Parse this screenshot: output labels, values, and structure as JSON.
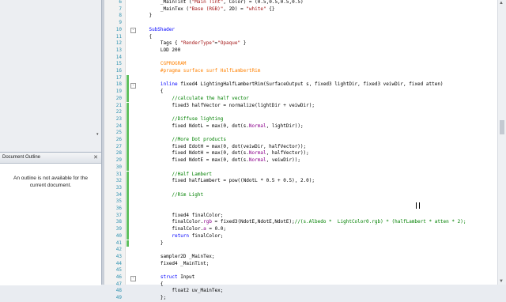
{
  "outline": {
    "title": "Document Outline",
    "close_glyph": "✕",
    "message": "An outline is not available for the current document."
  },
  "colors": {
    "keyword": "#0000ff",
    "string": "#a31515",
    "comment": "#008000",
    "number": "#000000",
    "preprocessor": "#ff8000",
    "field": "#8b008b",
    "changed": "#5fbf5f"
  },
  "code_lines": [
    {
      "n": "6",
      "fold": "",
      "changed": false,
      "segs": [
        {
          "t": "        ",
          "c": ""
        },
        {
          "t": "_MainTint",
          "c": ""
        },
        {
          "t": " (",
          "c": ""
        },
        {
          "t": "\"Main Tint\"",
          "c": "str"
        },
        {
          "t": ", Color) = (",
          "c": ""
        },
        {
          "t": "0.5,0.5,0.5,0.5",
          "c": "num"
        },
        {
          "t": ")",
          "c": ""
        }
      ]
    },
    {
      "n": "7",
      "fold": "",
      "changed": false,
      "segs": [
        {
          "t": "        _MainTex (",
          "c": ""
        },
        {
          "t": "\"Base (RGB)\"",
          "c": "str"
        },
        {
          "t": ", 2D) = ",
          "c": ""
        },
        {
          "t": "\"white\"",
          "c": "str"
        },
        {
          "t": " {}",
          "c": ""
        }
      ]
    },
    {
      "n": "8",
      "fold": "",
      "changed": false,
      "segs": [
        {
          "t": "    }",
          "c": ""
        }
      ]
    },
    {
      "n": "9",
      "fold": "",
      "changed": false,
      "segs": [
        {
          "t": "",
          "c": ""
        }
      ]
    },
    {
      "n": "10",
      "fold": "-",
      "changed": false,
      "segs": [
        {
          "t": "    ",
          "c": ""
        },
        {
          "t": "SubShader",
          "c": "kw"
        }
      ]
    },
    {
      "n": "11",
      "fold": "",
      "changed": false,
      "segs": [
        {
          "t": "    {",
          "c": ""
        }
      ]
    },
    {
      "n": "12",
      "fold": "",
      "changed": false,
      "segs": [
        {
          "t": "        Tags { ",
          "c": ""
        },
        {
          "t": "\"RenderType\"",
          "c": "str"
        },
        {
          "t": "=",
          "c": ""
        },
        {
          "t": "\"Opaque\"",
          "c": "str"
        },
        {
          "t": " }",
          "c": ""
        }
      ]
    },
    {
      "n": "13",
      "fold": "",
      "changed": false,
      "segs": [
        {
          "t": "        LOD ",
          "c": ""
        },
        {
          "t": "200",
          "c": "num"
        }
      ]
    },
    {
      "n": "14",
      "fold": "",
      "changed": false,
      "segs": [
        {
          "t": "",
          "c": ""
        }
      ]
    },
    {
      "n": "15",
      "fold": "",
      "changed": false,
      "segs": [
        {
          "t": "        ",
          "c": ""
        },
        {
          "t": "CGPROGRAM",
          "c": "pre"
        }
      ]
    },
    {
      "n": "16",
      "fold": "",
      "changed": false,
      "segs": [
        {
          "t": "        ",
          "c": ""
        },
        {
          "t": "#pragma surface surf HalfLambertRim",
          "c": "pre"
        }
      ]
    },
    {
      "n": "17",
      "fold": "",
      "changed": true,
      "segs": [
        {
          "t": "",
          "c": ""
        }
      ]
    },
    {
      "n": "18",
      "fold": "-",
      "changed": true,
      "segs": [
        {
          "t": "        ",
          "c": ""
        },
        {
          "t": "inline",
          "c": "kw"
        },
        {
          "t": " fixed4 LightingHalfLambertRim(SurfaceOutput s, fixed3 lightDir, fixed3 veiwDir, fixed atten)",
          "c": ""
        }
      ]
    },
    {
      "n": "19",
      "fold": "",
      "changed": true,
      "segs": [
        {
          "t": "        {",
          "c": ""
        }
      ]
    },
    {
      "n": "20",
      "fold": "",
      "changed": true,
      "segs": [
        {
          "t": "            ",
          "c": ""
        },
        {
          "t": "//calculate the half vector",
          "c": "com"
        }
      ]
    },
    {
      "n": "21",
      "fold": "",
      "changed": true,
      "segs": [
        {
          "t": "            fixed3 halfVector = normalize(lightDir + veiwDir);",
          "c": ""
        }
      ]
    },
    {
      "n": "22",
      "fold": "",
      "changed": true,
      "segs": [
        {
          "t": "",
          "c": ""
        }
      ]
    },
    {
      "n": "23",
      "fold": "",
      "changed": true,
      "segs": [
        {
          "t": "            ",
          "c": ""
        },
        {
          "t": "//Diffuse lighting",
          "c": "com"
        }
      ]
    },
    {
      "n": "24",
      "fold": "",
      "changed": true,
      "segs": [
        {
          "t": "            fixed NdotL = max(",
          "c": ""
        },
        {
          "t": "0",
          "c": "num"
        },
        {
          "t": ", dot(s.",
          "c": ""
        },
        {
          "t": "Normal",
          "c": "fld"
        },
        {
          "t": ", lightDir));",
          "c": ""
        }
      ]
    },
    {
      "n": "25",
      "fold": "",
      "changed": true,
      "segs": [
        {
          "t": "",
          "c": ""
        }
      ]
    },
    {
      "n": "26",
      "fold": "",
      "changed": true,
      "segs": [
        {
          "t": "            ",
          "c": ""
        },
        {
          "t": "//More Dot products",
          "c": "com"
        }
      ]
    },
    {
      "n": "27",
      "fold": "",
      "changed": true,
      "segs": [
        {
          "t": "            fixed EdotH = max(",
          "c": ""
        },
        {
          "t": "0",
          "c": "num"
        },
        {
          "t": ", dot(veiwDir, halfVector));",
          "c": ""
        }
      ]
    },
    {
      "n": "28",
      "fold": "",
      "changed": true,
      "segs": [
        {
          "t": "            fixed NdotH = max(",
          "c": ""
        },
        {
          "t": "0",
          "c": "num"
        },
        {
          "t": ", dot(s.",
          "c": ""
        },
        {
          "t": "Normal",
          "c": "fld"
        },
        {
          "t": ", halfVector));",
          "c": ""
        }
      ]
    },
    {
      "n": "29",
      "fold": "",
      "changed": true,
      "segs": [
        {
          "t": "            fixed NdotE = max(",
          "c": ""
        },
        {
          "t": "0",
          "c": "num"
        },
        {
          "t": ", dot(s.",
          "c": ""
        },
        {
          "t": "Normal",
          "c": "fld"
        },
        {
          "t": ", veiwDir));",
          "c": ""
        }
      ]
    },
    {
      "n": "30",
      "fold": "",
      "changed": true,
      "segs": [
        {
          "t": "",
          "c": ""
        }
      ]
    },
    {
      "n": "31",
      "fold": "",
      "changed": true,
      "segs": [
        {
          "t": "            ",
          "c": ""
        },
        {
          "t": "//Half Lambert",
          "c": "com"
        }
      ]
    },
    {
      "n": "32",
      "fold": "",
      "changed": true,
      "segs": [
        {
          "t": "            fixed halfLambert = pow((NdotL * ",
          "c": ""
        },
        {
          "t": "0.5",
          "c": "num"
        },
        {
          "t": " + ",
          "c": ""
        },
        {
          "t": "0.5",
          "c": "num"
        },
        {
          "t": "), ",
          "c": ""
        },
        {
          "t": "2.0",
          "c": "num"
        },
        {
          "t": ");",
          "c": ""
        }
      ]
    },
    {
      "n": "33",
      "fold": "",
      "changed": true,
      "segs": [
        {
          "t": "",
          "c": ""
        }
      ]
    },
    {
      "n": "34",
      "fold": "",
      "changed": true,
      "segs": [
        {
          "t": "            ",
          "c": ""
        },
        {
          "t": "//Rim Light",
          "c": "com"
        }
      ]
    },
    {
      "n": "35",
      "fold": "",
      "changed": true,
      "segs": [
        {
          "t": "",
          "c": ""
        }
      ]
    },
    {
      "n": "36",
      "fold": "",
      "changed": true,
      "segs": [
        {
          "t": "",
          "c": ""
        }
      ]
    },
    {
      "n": "37",
      "fold": "",
      "changed": true,
      "segs": [
        {
          "t": "            fixed4 finalColor;",
          "c": ""
        }
      ]
    },
    {
      "n": "38",
      "fold": "",
      "changed": true,
      "segs": [
        {
          "t": "            finalColor.",
          "c": ""
        },
        {
          "t": "rgb",
          "c": "fld"
        },
        {
          "t": " = fixed3(NdotE,NdotE,NdotE);",
          "c": ""
        },
        {
          "t": "//(s.Albedo *  LightColor0.rgb) * (halfLambert * atten * 2);",
          "c": "com"
        }
      ]
    },
    {
      "n": "39",
      "fold": "",
      "changed": true,
      "segs": [
        {
          "t": "            finalColor.",
          "c": ""
        },
        {
          "t": "a",
          "c": "fld"
        },
        {
          "t": " = ",
          "c": ""
        },
        {
          "t": "0.0",
          "c": "num"
        },
        {
          "t": ";",
          "c": ""
        }
      ]
    },
    {
      "n": "40",
      "fold": "",
      "changed": true,
      "segs": [
        {
          "t": "            ",
          "c": ""
        },
        {
          "t": "return",
          "c": "kw"
        },
        {
          "t": " finalColor;",
          "c": ""
        }
      ]
    },
    {
      "n": "41",
      "fold": "",
      "changed": true,
      "segs": [
        {
          "t": "        }",
          "c": ""
        }
      ]
    },
    {
      "n": "42",
      "fold": "",
      "changed": false,
      "segs": [
        {
          "t": "",
          "c": ""
        }
      ]
    },
    {
      "n": "43",
      "fold": "",
      "changed": false,
      "segs": [
        {
          "t": "        sampler2D _MainTex;",
          "c": ""
        }
      ]
    },
    {
      "n": "44",
      "fold": "",
      "changed": false,
      "segs": [
        {
          "t": "        fixed4 _MainTint;",
          "c": ""
        }
      ]
    },
    {
      "n": "45",
      "fold": "",
      "changed": false,
      "segs": [
        {
          "t": "",
          "c": ""
        }
      ]
    },
    {
      "n": "46",
      "fold": "-",
      "changed": false,
      "segs": [
        {
          "t": "        ",
          "c": ""
        },
        {
          "t": "struct",
          "c": "kw"
        },
        {
          "t": " Input",
          "c": ""
        }
      ]
    },
    {
      "n": "47",
      "fold": "",
      "changed": false,
      "segs": [
        {
          "t": "        {",
          "c": ""
        }
      ]
    },
    {
      "n": "48",
      "fold": "",
      "changed": false,
      "segs": [
        {
          "t": "            float2 uv_MainTex;",
          "c": ""
        }
      ]
    },
    {
      "n": "49",
      "fold": "",
      "changed": false,
      "segs": [
        {
          "t": "        };",
          "c": ""
        }
      ]
    }
  ],
  "scrollbar": {
    "up_glyph": "▲",
    "down_glyph": "▼"
  }
}
